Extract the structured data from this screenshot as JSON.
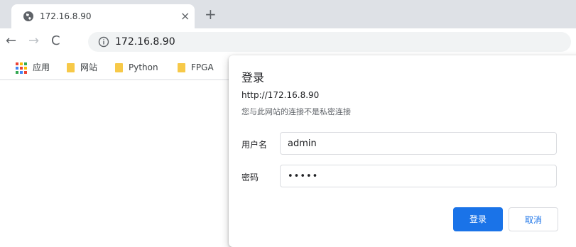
{
  "tab": {
    "title": "172.16.8.90",
    "close_label": "×",
    "favicon": "globe-icon"
  },
  "newtab_label": "+",
  "nav": {
    "back_label": "←",
    "forward_label": "→",
    "reload_label": "C"
  },
  "omnibox": {
    "icon": "info-icon",
    "url": "172.16.8.90"
  },
  "bookmarks": [
    {
      "label": "应用",
      "icon": "apps-grid-icon"
    },
    {
      "label": "网站",
      "icon": "folder-icon"
    },
    {
      "label": "Python",
      "icon": "folder-icon"
    },
    {
      "label": "FPGA",
      "icon": "folder-icon"
    }
  ],
  "colors": {
    "folder": "#f7c948",
    "accent": "#1a73e8"
  },
  "dialog": {
    "title": "登录",
    "origin": "http://172.16.8.90",
    "warning": "您与此网站的连接不是私密连接",
    "username_label": "用户名",
    "username_value": "admin",
    "password_label": "密码",
    "password_value": "•••••",
    "ok_label": "登录",
    "cancel_label": "取消"
  }
}
